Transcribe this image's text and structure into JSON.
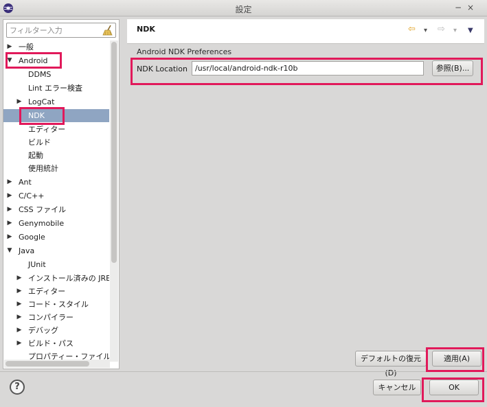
{
  "window": {
    "title": "設定",
    "minimize_glyph": "−",
    "close_glyph": "×"
  },
  "filter": {
    "placeholder": "フィルター入力"
  },
  "tree": {
    "items": [
      {
        "label": "一般",
        "twisty": "▶"
      },
      {
        "label": "Android",
        "twisty": "▼"
      },
      {
        "label": "DDMS",
        "twisty": ""
      },
      {
        "label": "Lint エラー検査",
        "twisty": ""
      },
      {
        "label": "LogCat",
        "twisty": "▶"
      },
      {
        "label": "NDK",
        "twisty": ""
      },
      {
        "label": "エディター",
        "twisty": ""
      },
      {
        "label": "ビルド",
        "twisty": ""
      },
      {
        "label": "起動",
        "twisty": ""
      },
      {
        "label": "使用統計",
        "twisty": ""
      },
      {
        "label": "Ant",
        "twisty": "▶"
      },
      {
        "label": "C/C++",
        "twisty": "▶"
      },
      {
        "label": "CSS ファイル",
        "twisty": "▶"
      },
      {
        "label": "Genymobile",
        "twisty": "▶"
      },
      {
        "label": "Google",
        "twisty": "▶"
      },
      {
        "label": "Java",
        "twisty": "▼"
      },
      {
        "label": "JUnit",
        "twisty": ""
      },
      {
        "label": "インストール済みの JRE",
        "twisty": "▶"
      },
      {
        "label": "エディター",
        "twisty": "▶"
      },
      {
        "label": "コード・スタイル",
        "twisty": "▶"
      },
      {
        "label": "コンパイラー",
        "twisty": "▶"
      },
      {
        "label": "デバッグ",
        "twisty": "▶"
      },
      {
        "label": "ビルド・パス",
        "twisty": "▶"
      },
      {
        "label": "プロパティー・ファイル・エ",
        "twisty": ""
      }
    ],
    "selected": "NDK"
  },
  "page": {
    "title": "NDK",
    "section_label": "Android NDK Preferences",
    "ndk_location_label": "NDK Location",
    "ndk_location_value": "/usr/local/android-ndk-r10b",
    "browse_label": "参照(B)...",
    "nav": {
      "back": "⇦",
      "back_menu": "▾",
      "forward": "⇨",
      "forward_menu": "▾",
      "view_menu": "▼"
    }
  },
  "buttons": {
    "restore_defaults": "デフォルトの復元(D)",
    "apply": "適用(A)",
    "cancel": "キャンセル",
    "ok": "OK",
    "help": "?"
  },
  "colors": {
    "highlight": "#e1195a",
    "selection": "#8fa5c2",
    "back_arrow": "#e0a020"
  }
}
